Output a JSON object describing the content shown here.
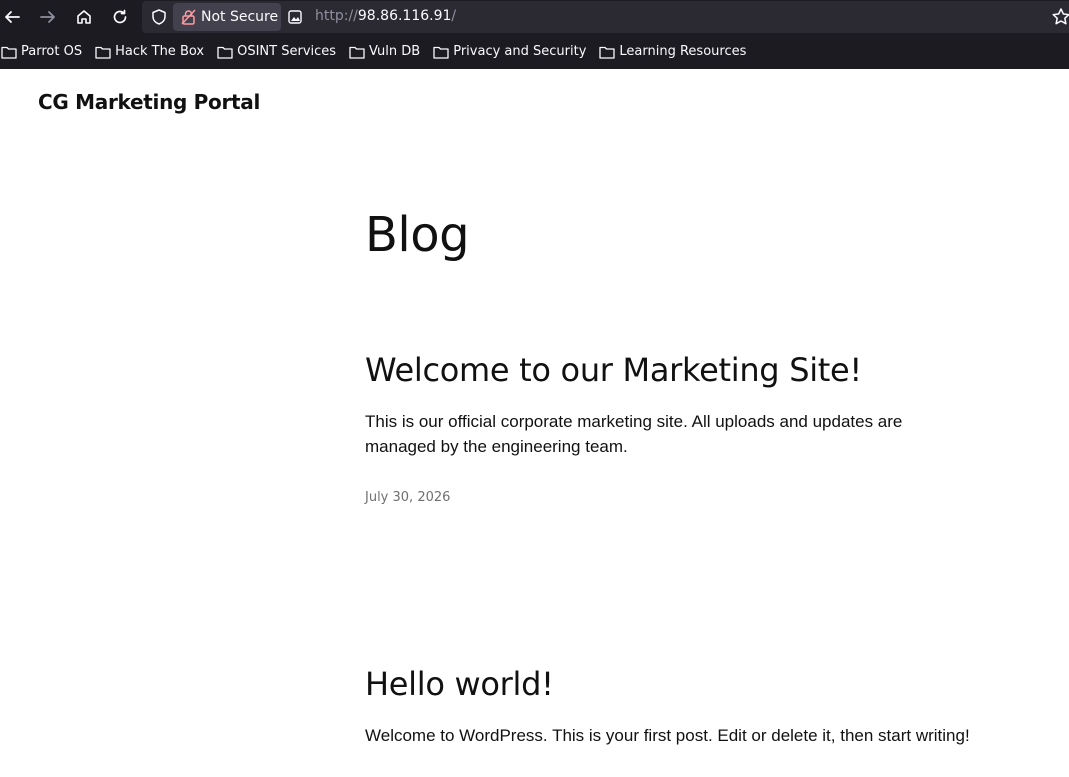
{
  "browser": {
    "security_label": "Not Secure",
    "url_scheme": "http://",
    "url_host": "98.86.116.91",
    "url_path": "/",
    "bookmarks": [
      {
        "label": "Parrot OS",
        "icon": "folder-icon"
      },
      {
        "label": "Hack The Box",
        "icon": "folder-icon"
      },
      {
        "label": "OSINT Services",
        "icon": "folder-icon"
      },
      {
        "label": "Vuln DB",
        "icon": "folder-icon"
      },
      {
        "label": "Privacy and Security",
        "icon": "folder-icon"
      },
      {
        "label": "Learning Resources",
        "icon": "folder-icon"
      }
    ]
  },
  "site": {
    "title": "CG Marketing Portal"
  },
  "main": {
    "heading": "Blog",
    "posts": [
      {
        "title": "Welcome to our Marketing Site!",
        "excerpt": "This is our official corporate marketing site. All uploads and updates are managed by the engineering team.",
        "date": "July 30, 2026"
      },
      {
        "title": "Hello world!",
        "excerpt": "Welcome to WordPress. This is your first post. Edit or delete it, then start writing!"
      }
    ]
  }
}
